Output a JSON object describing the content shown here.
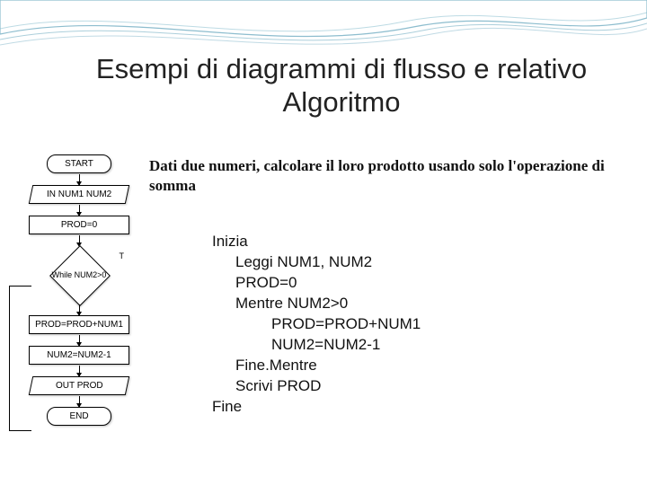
{
  "title": "Esempi di diagrammi di flusso e relativo Algoritmo",
  "description": "Dati due numeri, calcolare il loro prodotto usando solo l'operazione di somma",
  "algorithm": {
    "l0": "Inizia",
    "l1": "Leggi NUM1, NUM2",
    "l2": "PROD=0",
    "l3": "Mentre NUM2>0",
    "l4": "PROD=PROD+NUM1",
    "l5": "NUM2=NUM2-1",
    "l6": "Fine.Mentre",
    "l7": "Scrivi PROD",
    "l8": "Fine"
  },
  "flowchart": {
    "start": "START",
    "input": "IN NUM1 NUM2",
    "init": "PROD=0",
    "cond": "While NUM2>0",
    "cond_true": "T",
    "add": "PROD=PROD+NUM1",
    "dec": "NUM2=NUM2-1",
    "output": "OUT PROD",
    "end": "END"
  }
}
